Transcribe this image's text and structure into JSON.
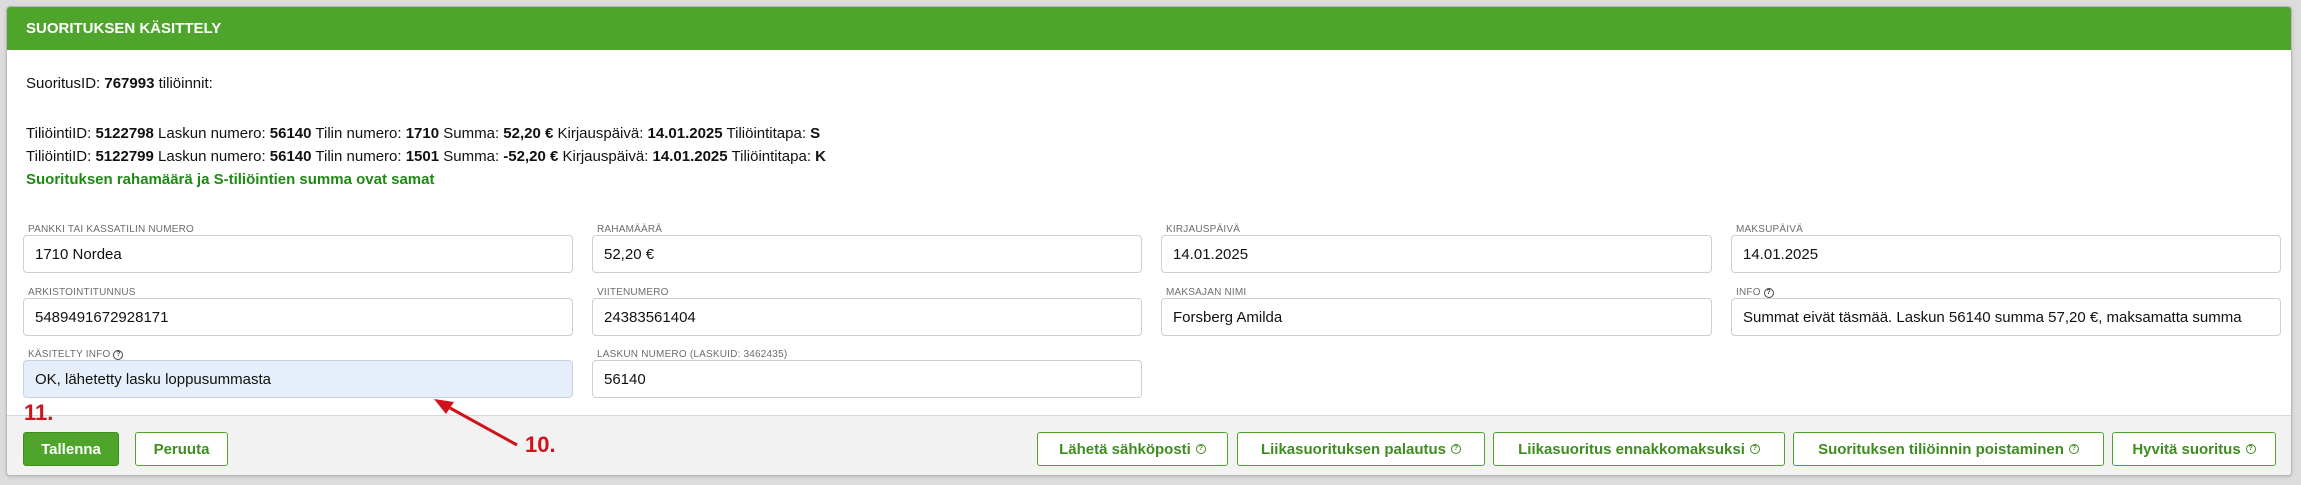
{
  "panel": {
    "title": "SUORITUKSEN KÄSITTELY",
    "suoritus_label": "SuoritusID: ",
    "suoritus_id": "767993",
    "suoritus_suffix": " tiliöinnit:"
  },
  "entries": [
    {
      "l_tiliointi": "TiliöintiID: ",
      "tiliointi_id": "5122798",
      "l_lasku": " Laskun numero: ",
      "lasku": "56140",
      "l_tili": " Tilin numero: ",
      "tili": "1710",
      "l_summa": " Summa: ",
      "summa": "52,20 €",
      "l_kirjaus": " Kirjauspäivä: ",
      "kirjaus": "14.01.2025",
      "l_tapa": " Tiliöintitapa: ",
      "tapa": "S"
    },
    {
      "l_tiliointi": "TiliöintiID: ",
      "tiliointi_id": "5122799",
      "l_lasku": " Laskun numero: ",
      "lasku": "56140",
      "l_tili": " Tilin numero: ",
      "tili": "1501",
      "l_summa": " Summa: ",
      "summa": "-52,20 €",
      "l_kirjaus": " Kirjauspäivä: ",
      "kirjaus": "14.01.2025",
      "l_tapa": " Tiliöintitapa: ",
      "tapa": "K"
    }
  ],
  "status_message": "Suorituksen rahamäärä ja S-tiliöintien summa ovat samat",
  "fields": {
    "pankki": {
      "label": "PANKKI TAI KASSATILIN NUMERO",
      "value": "1710 Nordea"
    },
    "rahamaara": {
      "label": "RAHAMÄÄRÄ",
      "value": "52,20 €"
    },
    "kirjauspaiva": {
      "label": "KIRJAUSPÄIVÄ",
      "value": "14.01.2025"
    },
    "maksupaiva": {
      "label": "MAKSUPÄIVÄ",
      "value": "14.01.2025"
    },
    "arkistointitunnus": {
      "label": "ARKISTOINTITUNNUS",
      "value": "5489491672928171"
    },
    "viitenumero": {
      "label": "VIITENUMERO",
      "value": "24383561404"
    },
    "maksajan_nimi": {
      "label": "MAKSAJAN NIMI",
      "value": "Forsberg Amilda"
    },
    "info": {
      "label": "INFO",
      "value": "Summat eivät täsmää. Laskun 56140 summa 57,20 €, maksamatta summa"
    },
    "kasitelty_info": {
      "label": "KÄSITELTY INFO",
      "value": "OK, lähetetty lasku loppusummasta"
    },
    "laskun_numero": {
      "label": "LASKUN NUMERO (LASKUID: 3462435)",
      "value": "56140"
    }
  },
  "buttons": {
    "save": "Tallenna",
    "cancel": "Peruuta",
    "send_email": "Lähetä sähköposti",
    "overpay_return": "Liikasuorituksen palautus",
    "overpay_advance": "Liikasuoritus ennakkomaksuksi",
    "delete_posting": "Suorituksen tiliöinnin poistaminen",
    "approve": "Hyvitä suoritus"
  },
  "annotations": {
    "step_save": "11.",
    "step_field": "10."
  },
  "colors": {
    "brand_green": "#4fa52c",
    "ok_text": "#1e8a14",
    "annotation_red": "#d0131a",
    "highlight_field": "#e6eef9"
  }
}
